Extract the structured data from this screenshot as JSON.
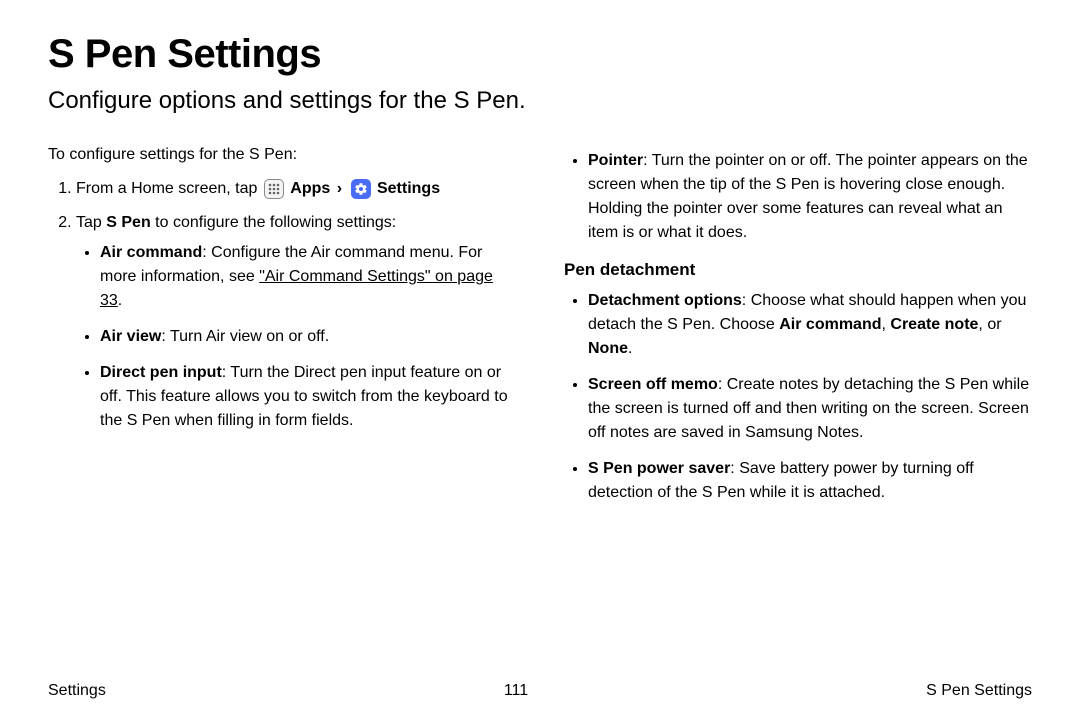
{
  "title": "S Pen Settings",
  "subtitle": "Configure options and settings for the S Pen.",
  "intro": "To configure settings for the S Pen:",
  "step1_prefix": "From a Home screen, tap ",
  "apps_label": "Apps",
  "chevron": "›",
  "settings_label": "Settings",
  "step2_prefix": "Tap ",
  "step2_bold": "S Pen",
  "step2_suffix": " to configure the following settings:",
  "left_bullets": {
    "aircmd_bold": "Air command",
    "aircmd_text": ": Configure the Air command menu. For more information, see ",
    "aircmd_link": "\"Air Command Settings\" on page 33",
    "aircmd_period": ".",
    "airview_bold": "Air view",
    "airview_text": ": Turn Air view on or off.",
    "dpi_bold": "Direct pen input",
    "dpi_text": ": Turn the Direct pen input feature on or off. This feature allows you to switch from the keyboard to the S Pen when filling in form fields."
  },
  "right_bullets": {
    "pointer_bold": "Pointer",
    "pointer_text": ": Turn the pointer on or off. The pointer appears on the screen when the tip of the S Pen is hovering close enough. Holding the pointer over some features can reveal what an item is or what it does."
  },
  "pen_detach_label": "Pen detachment",
  "detach_bullets": {
    "opt_bold": "Detachment options",
    "opt_text": ": Choose what should happen when you detach the S Pen. Choose ",
    "opt_b1": "Air command",
    "opt_sep1": ", ",
    "opt_b2": "Create note",
    "opt_sep2": ", or ",
    "opt_b3": "None",
    "opt_period": ".",
    "som_bold": "Screen off memo",
    "som_text": ": Create notes by detaching the S Pen while the screen is turned off and then writing on the screen. Screen off notes are saved in Samsung Notes.",
    "sps_bold": "S Pen power saver",
    "sps_text": ": Save battery power by turning off detection of the S Pen while it is attached."
  },
  "footer": {
    "left": "Settings",
    "center": "111",
    "right": "S Pen Settings"
  }
}
